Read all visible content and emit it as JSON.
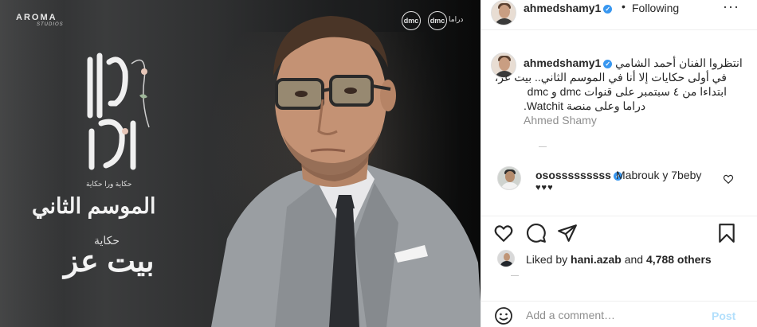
{
  "media": {
    "brand_logo": "AROMA",
    "brand_sub": "STUDIOS",
    "channel_logos": [
      "dmc",
      "dmc",
      "دراما"
    ],
    "title_art": "إلا أنا",
    "title_tagline": "حكاية ورا حكاية",
    "season_text": "الموسم الثاني",
    "story_label": "حكاية",
    "story_title": "بيت عز"
  },
  "header": {
    "username": "ahmedshamy1",
    "separator": "•",
    "follow_status": "Following",
    "more": "···"
  },
  "caption": {
    "username": "ahmedshamy1",
    "lines": [
      "انتظروا الفنان أحمد الشامي",
      "في أولى حكايات إلا أنا في الموسم الثاني.. بيت عز،",
      "ابتداءا من ٤ سبتمبر على قنوات dmc و dmc",
      "دراما وعلى منصة Watchit."
    ],
    "signature": "Ahmed Shamy"
  },
  "comment": {
    "username": "ososssssssss",
    "text": "Mabrouk y 7beby",
    "hearts": "♥♥♥"
  },
  "likes": {
    "prefix": "Liked by",
    "user": "hani.azab",
    "middle": "and",
    "count_text": "4,788 others"
  },
  "add_comment": {
    "placeholder": "Add a comment…",
    "post_label": "Post"
  },
  "icons": {
    "verified": "verified-badge-icon",
    "like": "heart-icon",
    "comment": "comment-bubble-icon",
    "share": "paper-plane-icon",
    "save": "bookmark-icon",
    "emoji": "smiley-icon"
  },
  "colors": {
    "verified_blue": "#3897f0",
    "post_disabled": "#b2dffc",
    "secondary_text": "#8e8e8e"
  }
}
